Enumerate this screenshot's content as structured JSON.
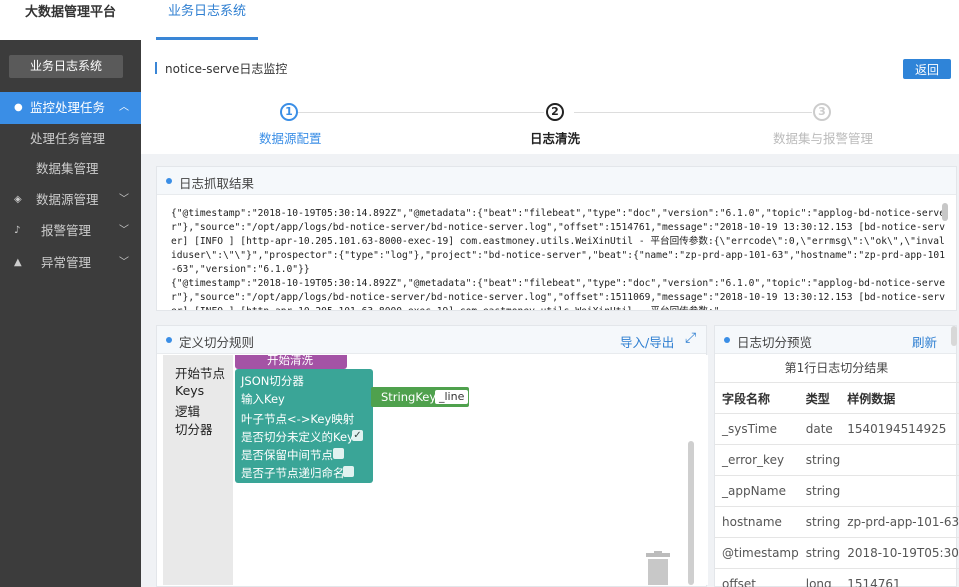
{
  "app": {
    "brand": "大数据管理平台",
    "top_tab": "业务日志系统"
  },
  "sidebar": {
    "title": "业务日志系统",
    "items": [
      {
        "label": "监控处理任务",
        "icon": "dashboard-icon",
        "active": true,
        "chevron": "chevron-up-icon"
      },
      {
        "label": "处理任务管理",
        "sub": true
      },
      {
        "label": "数据集管理",
        "sub": true
      },
      {
        "label": "数据源管理",
        "icon": "database-icon",
        "chevron": "chevron-down-icon"
      },
      {
        "label": "报警管理",
        "icon": "bell-icon",
        "chevron": "chevron-down-icon"
      },
      {
        "label": "异常管理",
        "icon": "warning-icon",
        "chevron": "chevron-down-icon"
      }
    ]
  },
  "header": {
    "title": "notice-serve日志监控",
    "back_label": "返回"
  },
  "steps": [
    {
      "num": "1",
      "label": "数据源配置",
      "state": "done"
    },
    {
      "num": "2",
      "label": "日志清洗",
      "state": "current"
    },
    {
      "num": "3",
      "label": "数据集与报警管理",
      "state": "pending"
    }
  ],
  "log_panel": {
    "title": "日志抓取结果",
    "content": "{\"@timestamp\":\"2018-10-19T05:30:14.892Z\",\"@metadata\":{\"beat\":\"filebeat\",\"type\":\"doc\",\"version\":\"6.1.0\",\"topic\":\"applog-bd-notice-server\"},\"source\":\"/opt/app/logs/bd-notice-server/bd-notice-server.log\",\"offset\":1514761,\"message\":\"2018-10-19 13:30:12.153 [bd-notice-server] [INFO ] [http-apr-10.205.101.63-8000-exec-19] com.eastmoney.utils.WeiXinUtil - 平台回传参数:{\\\"errcode\\\":0,\\\"errmsg\\\":\\\"ok\\\",\\\"invaliduser\\\":\\\"\\\"}\",\"prospector\":{\"type\":\"log\"},\"project\":\"bd-notice-server\",\"beat\":{\"name\":\"zp-prd-app-101-63\",\"hostname\":\"zp-prd-app-101-63\",\"version\":\"6.1.0\"}}\n{\"@timestamp\":\"2018-10-19T05:30:14.892Z\",\"@metadata\":{\"beat\":\"filebeat\",\"type\":\"doc\",\"version\":\"6.1.0\",\"topic\":\"applog-bd-notice-server\"},\"source\":\"/opt/app/logs/bd-notice-server/bd-notice-server.log\",\"offset\":1511069,\"message\":\"2018-10-19 13:30:12.153 [bd-notice-server] [INFO ] [http-apr-10.205.101.63-8000-exec-19] com.eastmoney.utils.WeiXinUtil - 平台回传参数:\""
  },
  "rules_panel": {
    "title": "定义切分规则",
    "import_export": "导入/导出",
    "toolbox": [
      "开始节点",
      "Keys",
      "逻辑",
      "切分器"
    ],
    "blocks": {
      "start": "开始清洗",
      "splitter_title": "JSON切分器",
      "input_key": "输入Key",
      "leaf_map": "叶子节点<->Key映射",
      "split_undefined": "是否切分未定义的Key",
      "keep_middle": "是否保留中间节点",
      "recursive_name": "是否子节点递归命名",
      "string_key": "StringKey",
      "string_key_value": "_line"
    },
    "checkboxes": {
      "split_undefined": true,
      "keep_middle": false,
      "recursive_name": false
    }
  },
  "preview_panel": {
    "title": "日志切分预览",
    "refresh": "刷新",
    "subtitle": "第1行日志切分结果",
    "columns": [
      "字段名称",
      "类型",
      "样例数据"
    ],
    "rows": [
      [
        "_sysTime",
        "date",
        "1540194514925"
      ],
      [
        "_error_key",
        "string",
        ""
      ],
      [
        "_appName",
        "string",
        ""
      ],
      [
        "hostname",
        "string",
        "zp-prd-app-101-63"
      ],
      [
        "@timestamp",
        "string",
        "2018-10-19T05:30:1"
      ],
      [
        "offset",
        "long",
        "1514761"
      ]
    ]
  },
  "colors": {
    "accent": "#3a8ee6",
    "sidebar": "#3c3c3c",
    "block_purple": "#a453a5",
    "block_teal": "#3aa597",
    "block_green": "#4fa14d"
  }
}
